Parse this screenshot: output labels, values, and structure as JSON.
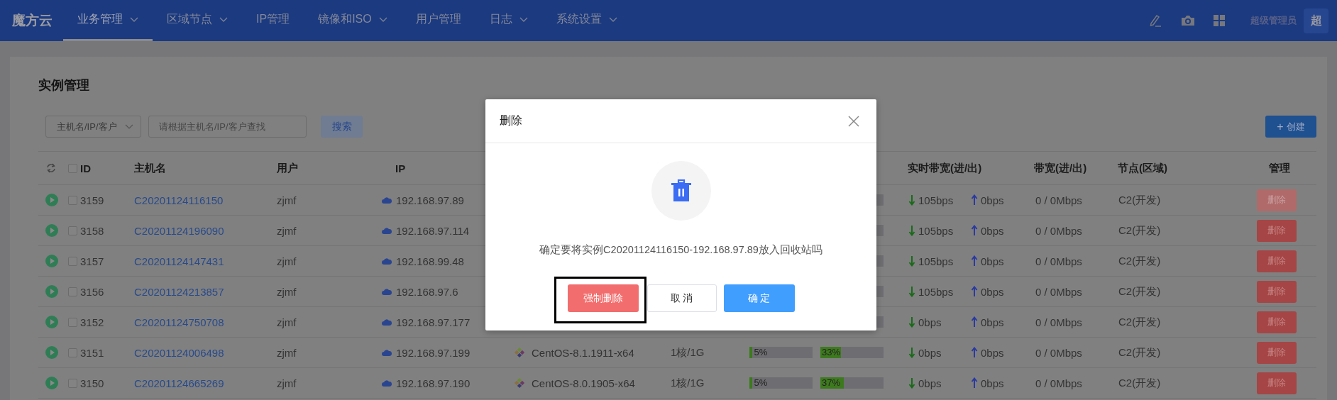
{
  "nav": {
    "logo": "魔方云",
    "items": [
      {
        "label": "业务管理",
        "dropdown": true,
        "selected": true
      },
      {
        "label": "区域节点",
        "dropdown": true,
        "selected": false
      },
      {
        "label": "IP管理",
        "dropdown": false,
        "selected": false
      },
      {
        "label": "镜像和ISO",
        "dropdown": true,
        "selected": false
      },
      {
        "label": "用户管理",
        "dropdown": false,
        "selected": false
      },
      {
        "label": "日志",
        "dropdown": true,
        "selected": false
      },
      {
        "label": "系统设置",
        "dropdown": true,
        "selected": false
      }
    ],
    "user": "超级管理员",
    "avatar": "超"
  },
  "page": {
    "title": "实例管理",
    "filter": {
      "select": "主机名/IP/客户",
      "placeholder": "请根据主机名/IP/客户查找",
      "search": "搜索"
    },
    "create_button": {
      "icon": "+",
      "label": "创建"
    }
  },
  "table": {
    "select_all_checked": false,
    "columns": [
      "ID",
      "主机名",
      "用户",
      "IP",
      "实时带宽(进/出)",
      "带宽(进/出)",
      "节点(区域)",
      "管理"
    ],
    "rows": [
      {
        "checked": false,
        "id": "3159",
        "host": "C20201124116150",
        "user": "zjmf",
        "ip": "192.168.97.89",
        "bw_in": "105bps",
        "bw_out": "0bps",
        "bandwidth": "0 / 0Mbps",
        "node": "C2(开发)",
        "action": "删除",
        "disabled": true
      },
      {
        "checked": false,
        "id": "3158",
        "host": "C20201124196090",
        "user": "zjmf",
        "ip": "192.168.97.114",
        "bw_in": "105bps",
        "bw_out": "0bps",
        "bandwidth": "0 / 0Mbps",
        "node": "C2(开发)",
        "action": "删除",
        "disabled": false
      },
      {
        "checked": false,
        "id": "3157",
        "host": "C20201124147431",
        "user": "zjmf",
        "ip": "192.168.99.48",
        "bw_in": "105bps",
        "bw_out": "0bps",
        "bandwidth": "0 / 0Mbps",
        "node": "C2(开发)",
        "action": "删除",
        "disabled": false
      },
      {
        "checked": false,
        "id": "3156",
        "host": "C20201124213857",
        "user": "zjmf",
        "ip": "192.168.97.6",
        "bw_in": "105bps",
        "bw_out": "0bps",
        "bandwidth": "0 / 0Mbps",
        "node": "C2(开发)",
        "action": "删除",
        "disabled": false
      },
      {
        "checked": false,
        "id": "3152",
        "host": "C20201124750708",
        "user": "zjmf",
        "ip": "192.168.97.177",
        "bw_in": "0bps",
        "bw_out": "0bps",
        "bandwidth": "0 / 0Mbps",
        "node": "C2(开发)",
        "action": "删除",
        "disabled": false
      },
      {
        "checked": false,
        "id": "3151",
        "host": "C20201124006498",
        "user": "zjmf",
        "ip": "192.168.97.199",
        "os": "CentOS-8.1.1911-x64",
        "config": "1核/1G",
        "cpu": {
          "level": 0.05,
          "reading": "5%"
        },
        "mem": {
          "level": 0.33,
          "reading": "33%"
        },
        "bw_in": "0bps",
        "bw_out": "0bps",
        "bandwidth": "0 / 0Mbps",
        "node": "C2(开发)",
        "action": "删除",
        "disabled": false
      },
      {
        "checked": false,
        "id": "3150",
        "host": "C20201124665269",
        "user": "zjmf",
        "ip": "192.168.97.190",
        "os": "CentOS-8.0.1905-x64",
        "config": "1核/1G",
        "cpu": {
          "level": 0.05,
          "reading": "5%"
        },
        "mem": {
          "level": 0.37,
          "reading": "37%"
        },
        "bw_in": "0bps",
        "bw_out": "0bps",
        "bandwidth": "0 / 0Mbps",
        "node": "C2(开发)",
        "action": "删除",
        "disabled": false
      }
    ]
  },
  "dialog": {
    "title": "删除",
    "message": "确定要将实例C20201124116150-192.168.97.89放入回收站吗",
    "buttons": [
      {
        "kind": "danger",
        "label": "强制删除",
        "highlighted": true
      },
      {
        "kind": "default",
        "label": "取 消",
        "highlighted": false
      },
      {
        "kind": "primary",
        "label": "确 定",
        "highlighted": false
      }
    ]
  }
}
